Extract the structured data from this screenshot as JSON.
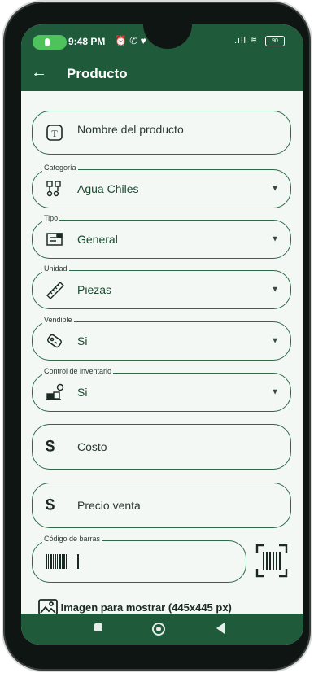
{
  "status_bar": {
    "time": "9:48 PM",
    "battery": "90"
  },
  "app_bar": {
    "title": "Producto"
  },
  "fields": {
    "nombre": {
      "placeholder": "Nombre del producto"
    },
    "categoria": {
      "label": "Categoría",
      "value": "Agua Chiles"
    },
    "tipo": {
      "label": "Tipo",
      "value": "General"
    },
    "unidad": {
      "label": "Unidad",
      "value": "Piezas"
    },
    "vendible": {
      "label": "Vendible",
      "value": "Si"
    },
    "control": {
      "label": "Control de inventario",
      "value": "Si"
    },
    "costo": {
      "placeholder": "Costo",
      "icon": "$"
    },
    "precio": {
      "placeholder": "Precio venta",
      "icon": "$"
    },
    "codigo": {
      "label": "Código de barras",
      "value": ""
    }
  },
  "image_row": {
    "label": "Imagen para mostrar (445x445 px)"
  },
  "colors": {
    "primary": "#1f5a3b",
    "border": "#2d6a47",
    "background": "#f4f8f5"
  }
}
